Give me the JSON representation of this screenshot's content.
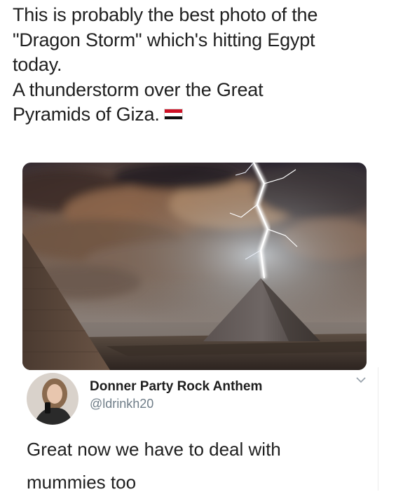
{
  "post": {
    "lines": [
      "This is probably the best photo of the",
      "\"Dragon Storm\" which's hitting Egypt",
      "today.",
      "A thunderstorm over the Great",
      "Pyramids of Giza."
    ],
    "flag_icon": "egypt-flag-icon",
    "flag_colors": [
      "#ce1126",
      "#ffffff",
      "#000000"
    ]
  },
  "photo": {
    "subject": "lightning-over-pyramid-photo"
  },
  "reply": {
    "display_name": "Donner Party Rock Anthem",
    "handle": "@ldrinkh20",
    "menu_icon": "chevron-down-icon",
    "lines": [
      "Great now we have to deal with",
      "mummies too"
    ]
  }
}
